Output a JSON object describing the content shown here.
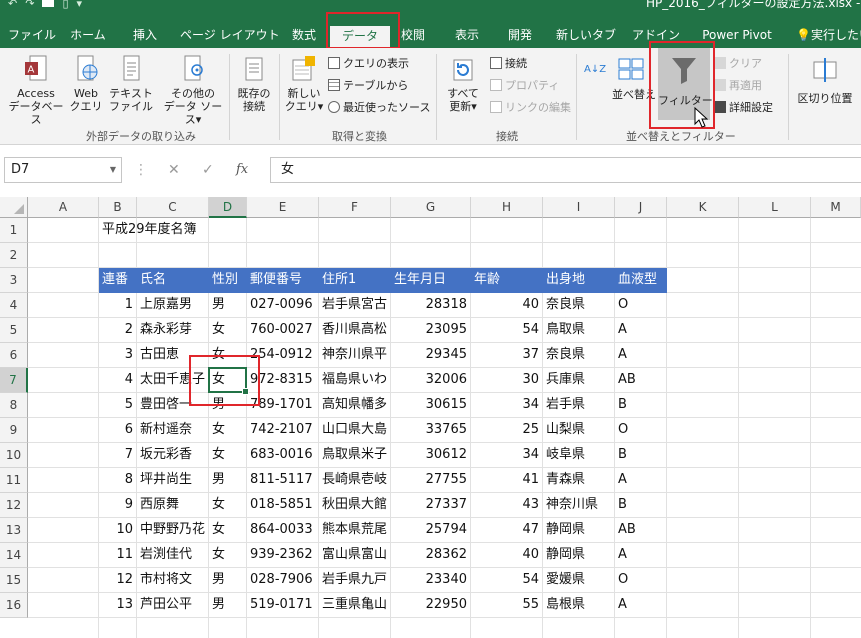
{
  "window": {
    "title": "HP_2016_フィルターの設定方法.xlsx - "
  },
  "tabs": [
    {
      "label": "ファイル"
    },
    {
      "label": "ホーム"
    },
    {
      "label": "挿入"
    },
    {
      "label": "ページ レイアウト"
    },
    {
      "label": "数式"
    },
    {
      "label": "データ"
    },
    {
      "label": "校閲"
    },
    {
      "label": "表示"
    },
    {
      "label": "開発"
    },
    {
      "label": "新しいタブ"
    },
    {
      "label": "アドイン"
    },
    {
      "label": "Power Pivot"
    },
    {
      "label": "実行したい"
    }
  ],
  "ribbon": {
    "access": "Access\nデータベース",
    "web": "Web\nクエリ",
    "text": "テキスト\nファイル",
    "other": "その他の\nデータ ソース▾",
    "external_group": "外部データの取り込み",
    "existing": "既存の\n接続",
    "new_query": "新しい\nクエリ▾",
    "show_queries": "クエリの表示",
    "from_table": "テーブルから",
    "recent_sources": "最近使ったソース",
    "get_transform_group": "取得と変換",
    "refresh_all": "すべて\n更新▾",
    "connections": "接続",
    "properties": "プロパティ",
    "edit_links": "リンクの編集",
    "connections_group": "接続",
    "sort_az": "A↓Z",
    "sort": "並べ替え",
    "filter": "フィルター",
    "clear": "クリア",
    "reapply": "再適用",
    "advanced": "詳細設定",
    "sort_filter_group": "並べ替えとフィルター",
    "text_to_columns": "区切り位置"
  },
  "formula_bar": {
    "name_box": "D7",
    "cancel": "✕",
    "enter": "✓",
    "fx": "fx",
    "value": "女"
  },
  "columns": [
    "A",
    "B",
    "C",
    "D",
    "E",
    "F",
    "G",
    "H",
    "I",
    "J",
    "K",
    "L",
    "M"
  ],
  "rows": [
    "1",
    "2",
    "3",
    "4",
    "5",
    "6",
    "7",
    "8",
    "9",
    "10",
    "11",
    "12",
    "13",
    "14",
    "15",
    "16"
  ],
  "sheet": {
    "title": "平成29年度名簿",
    "headers": [
      "連番",
      "氏名",
      "性別",
      "郵便番号",
      "住所1",
      "生年月日",
      "年齢",
      "出身地",
      "血液型"
    ],
    "records": [
      [
        "1",
        "上原嘉男",
        "男",
        "027-0096",
        "岩手県宮古",
        "28318",
        "40",
        "奈良県",
        "O"
      ],
      [
        "2",
        "森永彩芽",
        "女",
        "760-0027",
        "香川県高松",
        "23095",
        "54",
        "鳥取県",
        "A"
      ],
      [
        "3",
        "古田恵",
        "女",
        "254-0912",
        "神奈川県平",
        "29345",
        "37",
        "奈良県",
        "A"
      ],
      [
        "4",
        "太田千恵子",
        "女",
        "972-8315",
        "福島県いわ",
        "32006",
        "30",
        "兵庫県",
        "AB"
      ],
      [
        "5",
        "豊田啓一",
        "男",
        "789-1701",
        "高知県幡多",
        "30615",
        "34",
        "岩手県",
        "B"
      ],
      [
        "6",
        "新村遥奈",
        "女",
        "742-2107",
        "山口県大島",
        "33765",
        "25",
        "山梨県",
        "O"
      ],
      [
        "7",
        "坂元彩香",
        "女",
        "683-0016",
        "鳥取県米子",
        "30612",
        "34",
        "岐阜県",
        "B"
      ],
      [
        "8",
        "坪井尚生",
        "男",
        "811-5117",
        "長崎県壱岐",
        "27755",
        "41",
        "青森県",
        "A"
      ],
      [
        "9",
        "西原舞",
        "女",
        "018-5851",
        "秋田県大館",
        "27337",
        "43",
        "神奈川県",
        "B"
      ],
      [
        "10",
        "中野野乃花",
        "女",
        "864-0033",
        "熊本県荒尾",
        "25794",
        "47",
        "静岡県",
        "AB"
      ],
      [
        "11",
        "岩渕佳代",
        "女",
        "939-2362",
        "富山県富山",
        "28362",
        "40",
        "静岡県",
        "A"
      ],
      [
        "12",
        "市村将文",
        "男",
        "028-7906",
        "岩手県九戸",
        "23340",
        "54",
        "愛媛県",
        "O"
      ],
      [
        "13",
        "芦田公平",
        "男",
        "519-0171",
        "三重県亀山",
        "22950",
        "55",
        "島根県",
        "A"
      ]
    ]
  }
}
